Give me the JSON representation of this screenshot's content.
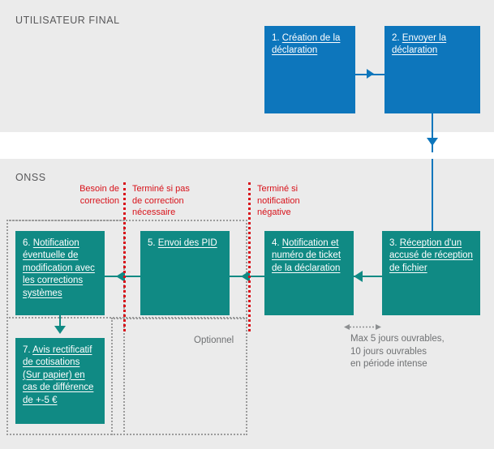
{
  "lanes": {
    "user": {
      "title": "UTILISATEUR FINAL"
    },
    "onss": {
      "title": "ONSS"
    }
  },
  "colors": {
    "blue": "#0d76bc",
    "teal": "#108a84",
    "red": "#d8121a",
    "band": "#ebebeb",
    "gray_text": "#6f7173",
    "lane_title": "#58585a"
  },
  "nodes": [
    {
      "id": 1,
      "num": "1. ",
      "label": "Création de la déclaration",
      "lane": "user",
      "color": "blue"
    },
    {
      "id": 2,
      "num": "2. ",
      "label": "Envoyer la déclaration",
      "lane": "user",
      "color": "blue"
    },
    {
      "id": 3,
      "num": "3. ",
      "label": "Réception d'un accusé de réception de fichier",
      "lane": "onss",
      "color": "teal"
    },
    {
      "id": 4,
      "num": "4. ",
      "label": "Notification et numéro de ticket de la déclaration",
      "lane": "onss",
      "color": "teal"
    },
    {
      "id": 5,
      "num": "5. ",
      "label": "Envoi des PID",
      "lane": "onss",
      "color": "teal"
    },
    {
      "id": 6,
      "num": "6. ",
      "label": "Notification éventuelle de modification avec les corrections systèmes",
      "lane": "onss",
      "color": "teal"
    },
    {
      "id": 7,
      "num": "7. ",
      "label": "Avis rectificatif de cotisations (Sur papier) en cas de différence de +-5 €",
      "lane": "onss",
      "color": "teal"
    }
  ],
  "decision_labels": [
    {
      "id": "besoin-de-correction",
      "text": "Besoin de\ncorrection"
    },
    {
      "id": "termine-si-pas-de-correction",
      "text": "Terminé si pas\nde correction\nnécessaire"
    },
    {
      "id": "termine-si-notification-negative",
      "text": "Terminé si\nnotification\nnégative"
    }
  ],
  "groups": {
    "optional_label": "Optionnel"
  },
  "duration": {
    "text": "Max 5 jours ouvrables,\n10 jours ouvrables\nen période intense"
  }
}
